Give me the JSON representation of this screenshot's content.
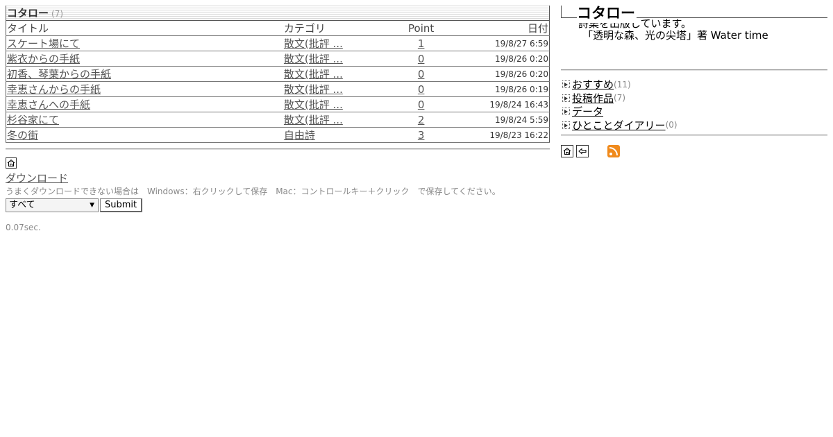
{
  "list": {
    "title": "コタロー",
    "count": "(7)",
    "headers": {
      "title": "タイトル",
      "category": "カテゴリ",
      "point": "Point",
      "date": "日付"
    },
    "rows": [
      {
        "title": "スケート場にて",
        "category": "散文(批評 ...",
        "point": "1",
        "date": "19/8/27 6:59"
      },
      {
        "title": "紫衣からの手紙",
        "category": "散文(批評 ...",
        "point": "0",
        "date": "19/8/26 0:20"
      },
      {
        "title": "初香、琴葉からの手紙",
        "category": "散文(批評 ...",
        "point": "0",
        "date": "19/8/26 0:20"
      },
      {
        "title": "幸恵さんからの手紙",
        "category": "散文(批評 ...",
        "point": "0",
        "date": "19/8/26 0:19"
      },
      {
        "title": "幸恵さんへの手紙",
        "category": "散文(批評 ...",
        "point": "0",
        "date": "19/8/24 16:43"
      },
      {
        "title": "杉谷家にて",
        "category": "散文(批評 ...",
        "point": "2",
        "date": "19/8/24 5:59"
      },
      {
        "title": "冬の街",
        "category": "自由詩",
        "point": "3",
        "date": "19/8/23 16:22"
      }
    ]
  },
  "download": {
    "home_icon": "home-icon",
    "link_label": "ダウンロード",
    "note": "うまくダウンロードできない場合は　Windows：右クリックして保存　Mac：コントロールキー＋クリック　で保存してください。",
    "select_value": "すべて",
    "submit_label": "Submit"
  },
  "elapsed": "0.07sec.",
  "profile": {
    "name": "コタロー",
    "desc_line1": "詩集を出版しています。",
    "desc_line2": "「透明な森、光の尖塔」著 Water time"
  },
  "categories": [
    {
      "label": "おすすめ",
      "count": "(11)"
    },
    {
      "label": "投稿作品",
      "count": "(7)"
    },
    {
      "label": "データ",
      "count": ""
    },
    {
      "label": "ひとことダイアリー",
      "count": "(0)"
    }
  ],
  "icons": [
    "home-icon",
    "back-icon",
    "rss-icon"
  ]
}
